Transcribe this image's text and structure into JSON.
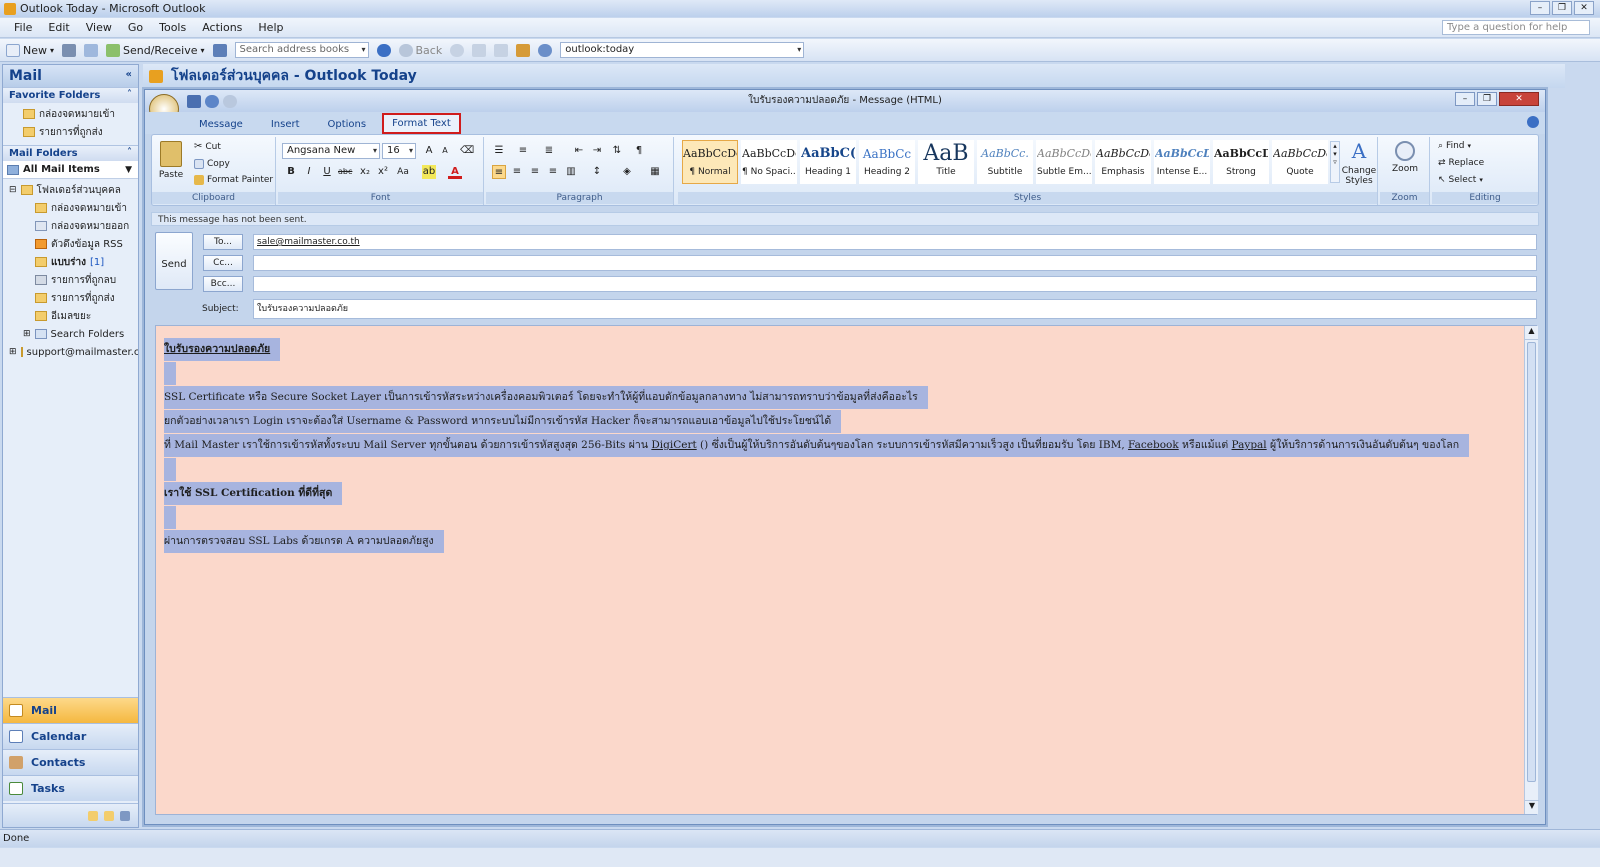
{
  "window": {
    "title": "Outlook Today - Microsoft Outlook"
  },
  "menu": [
    "File",
    "Edit",
    "View",
    "Go",
    "Tools",
    "Actions",
    "Help"
  ],
  "help_placeholder": "Type a question for help",
  "toolbar": {
    "new": "New",
    "send_receive": "Send/Receive",
    "search_address": "Search address books",
    "back": "Back",
    "address": "outlook:today"
  },
  "nav": {
    "title": "Mail",
    "favorites_header": "Favorite Folders",
    "favorites": [
      "กล่องจดหมายเข้า",
      "รายการที่ถูกส่ง"
    ],
    "mail_folders_header": "Mail Folders",
    "all_mail_items": "All Mail Items",
    "root": "โฟลเดอร์ส่วนบุคคล",
    "folders": [
      "กล่องจดหมายเข้า",
      "กล่องจดหมายออก",
      "ตัวดึงข้อมูล RSS",
      "แบบร่าง",
      "รายการที่ถูกลบ",
      "รายการที่ถูกส่ง",
      "อีเมลขยะ"
    ],
    "drafts_count": "[1]",
    "search_folders": "Search Folders",
    "account": "support@mailmaster.co",
    "buttons": [
      "Mail",
      "Calendar",
      "Contacts",
      "Tasks"
    ]
  },
  "main_header": "โฟลเดอร์ส่วนบุคคล - Outlook Today",
  "message": {
    "title": "ใบรับรองความปลอดภัย - Message (HTML)",
    "tabs": [
      "Message",
      "Insert",
      "Options",
      "Format Text"
    ],
    "active_tab": "Format Text",
    "ribbon": {
      "clipboard": {
        "label": "Clipboard",
        "paste": "Paste",
        "cut": "Cut",
        "copy": "Copy",
        "format_painter": "Format Painter"
      },
      "font": {
        "label": "Font",
        "name": "Angsana New",
        "size": "16"
      },
      "paragraph": {
        "label": "Paragraph"
      },
      "styles": {
        "label": "Styles",
        "items": [
          {
            "sample": "AaBbCcDc",
            "name": "¶ Normal"
          },
          {
            "sample": "AaBbCcDc",
            "name": "¶ No Spaci..."
          },
          {
            "sample": "AaBbC(",
            "name": "Heading 1"
          },
          {
            "sample": "AaBbCc",
            "name": "Heading 2"
          },
          {
            "sample": "AaB",
            "name": "Title"
          },
          {
            "sample": "AaBbCc.",
            "name": "Subtitle"
          },
          {
            "sample": "AaBbCcDc",
            "name": "Subtle Em..."
          },
          {
            "sample": "AaBbCcDc",
            "name": "Emphasis"
          },
          {
            "sample": "AaBbCcDc",
            "name": "Intense E..."
          },
          {
            "sample": "AaBbCcDc",
            "name": "Strong"
          },
          {
            "sample": "AaBbCcDc",
            "name": "Quote"
          }
        ],
        "change_styles": "Change Styles"
      },
      "zoom": {
        "label": "Zoom",
        "button": "Zoom"
      },
      "editing": {
        "label": "Editing",
        "find": "Find",
        "replace": "Replace",
        "select": "Select"
      }
    },
    "info": "This message has not been sent.",
    "send": "Send",
    "to_label": "To...",
    "cc_label": "Cc...",
    "bcc_label": "Bcc...",
    "subject_label": "Subject:",
    "to": "sale@mailmaster.co.th",
    "cc": "",
    "bcc": "",
    "subject": "ใบรับรองความปลอดภัย",
    "body": {
      "title": "ใบรับรองความปลอดภัย",
      "p1": "SSL Certificate หรือ Secure Socket Layer เป็นการเข้ารหัสระหว่างเครื่องคอมพิวเตอร์ โดยจะทำให้ผู้ที่แอบดักข้อมูลกลางทาง ไม่สามารถทราบว่าข้อมูลที่ส่งคืออะไร",
      "p2": "ยกตัวอย่างเวลาเรา Login เราจะต้องใส่ Username & Password หากระบบไม่มีการเข้ารหัส Hacker ก็จะสามารถแอบเอาข้อมูลไปใช้ประโยชน์ได้",
      "p3a": "ที่ Mail Master เราใช้การเข้ารหัสทั้งระบบ Mail Server ทุกขั้นตอน ด้วยการเข้ารหัสสูงสุด 256-Bits ผ่าน ",
      "digicert": "DigiCert",
      "p3b": " ()  ซึ่งเป็นผู้ให้บริการอันดับต้นๆของโลก ระบบการเข้ารหัสมีความเร็วสูง เป็นที่ยอมรับ โดย IBM, ",
      "facebook": "Facebook",
      "p3c": " หรือแม้แต่ ",
      "paypal": "Paypal",
      "p3d": " ผู้ให้บริการด้านการเงินอันดับต้นๆ ของโลก",
      "h2": "เราใช้ SSL Certification ที่ดีที่สุด",
      "p4": "ผ่านการตรวจสอบ SSL Labs ด้วยเกรด A ความปลอดภัยสูง"
    }
  },
  "status": "Done",
  "accent": "#d01c1c"
}
